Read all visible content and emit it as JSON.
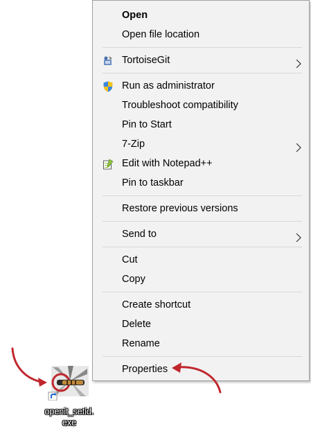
{
  "context_menu": {
    "items": [
      {
        "label": "Open"
      },
      {
        "label": "Open file location"
      },
      {
        "label": "TortoiseGit"
      },
      {
        "label": "Run as administrator"
      },
      {
        "label": "Troubleshoot compatibility"
      },
      {
        "label": "Pin to Start"
      },
      {
        "label": "7-Zip"
      },
      {
        "label": "Edit with Notepad++"
      },
      {
        "label": "Pin to taskbar"
      },
      {
        "label": "Restore previous versions"
      },
      {
        "label": "Send to"
      },
      {
        "label": "Cut"
      },
      {
        "label": "Copy"
      },
      {
        "label": "Create shortcut"
      },
      {
        "label": "Delete"
      },
      {
        "label": "Rename"
      },
      {
        "label": "Properties"
      }
    ]
  },
  "desktop_icon": {
    "label": "openit_setid.\nexe",
    "icon": "application-shortcut-icon"
  },
  "annotations": {
    "arrow_color": "#c0272d"
  }
}
